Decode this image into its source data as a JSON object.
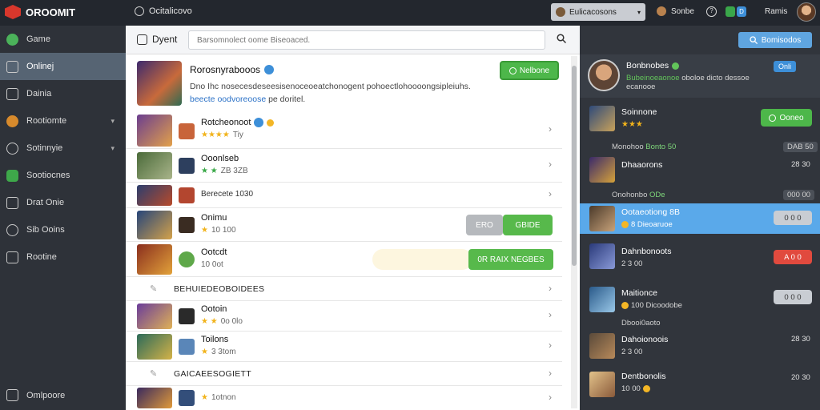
{
  "topbar": {
    "app_name": "OROOMIT",
    "page_title": "Ocitalicovo",
    "dropdown_label": "Eulicacosons",
    "user_label": "Sonbe",
    "help_glyph": "?",
    "badge_1": "",
    "badge_2": "D",
    "account_name": "Ramis"
  },
  "sidebar": {
    "items": [
      {
        "label": "Game",
        "icon": "game-icon"
      },
      {
        "label": "Onlinej",
        "icon": "monitor-icon"
      },
      {
        "label": "Dainia",
        "icon": "document-icon"
      },
      {
        "label": "Rootiomte",
        "icon": "orange-globe-icon"
      },
      {
        "label": "Sotinnyie",
        "icon": "cloud-icon"
      },
      {
        "label": "Sootiocnes",
        "icon": "green-badge-icon"
      },
      {
        "label": "Drat Onie",
        "icon": "grid-icon"
      },
      {
        "label": "Sib Ooins",
        "icon": "circle-arrow-icon"
      },
      {
        "label": "Rootine",
        "icon": "table-icon"
      }
    ],
    "footer_label": "Omlpoore"
  },
  "main": {
    "header_label": "Dyent",
    "search_placeholder": "Barsomnolect oome Biseoaced.",
    "featured": {
      "title": "Rorosnyrabooos",
      "desc_line1": "Dno Ihc nosecesdeseesisenoceoeatchonogent pohoectlohoooongsipleiuhs.",
      "desc_link": "beecte oodvoreoose",
      "desc_line2_rest": "pe doritel.",
      "action_label": "Nelbone"
    },
    "rows": [
      {
        "title": "Rotcheonoot",
        "sub": "Tiy",
        "stars": "★★★★"
      },
      {
        "title": "Ooonlseb",
        "sub": "ZB 3ZB",
        "stars": "★ ★"
      },
      {
        "title": "",
        "sub": "Berecete 1030",
        "stars": ""
      },
      {
        "title": "Onimu",
        "sub": "10 100",
        "stars": "★",
        "btn_gray": "ERO",
        "btn_green": "GBIDE"
      },
      {
        "title": "Ootcdt",
        "sub": "10 0ot",
        "stars": "",
        "btn_green": "0R RAIX NEGBES"
      },
      {
        "title": "Ootoin",
        "sub": "0o 0lo",
        "stars": "★ ★"
      },
      {
        "title": "Toilons",
        "sub": "3 3tom",
        "stars": "★"
      },
      {
        "title": "",
        "sub": "1otnon",
        "stars": "★"
      }
    ],
    "sections": [
      "BEHUIEDEOBOIDEES",
      "GAICAEESOGIETT"
    ],
    "chevron": "›"
  },
  "right": {
    "search_label": "Bomisodos",
    "profile": {
      "name": "Bonbnobes",
      "status_prefix": "Bubeinoeaonoe",
      "status_rest": "oboloe dicto dessoe",
      "status_line2": "ecanooe",
      "tag": "Onli"
    },
    "items": [
      {
        "title": "Soinnone",
        "meta": "★★★",
        "action": "Ooneo"
      },
      {
        "title": "Dhaaorons",
        "meta": "",
        "count": "28 30"
      },
      {
        "title": "Ootaeotiong 8B",
        "meta": "8 Dieoaruoe",
        "action": "0 0 0"
      },
      {
        "title": "Dahnbonoots",
        "meta": "2 3 00",
        "action": "A 0 0"
      },
      {
        "title": "Maitionce",
        "meta": "100 Dicoodobe",
        "action": "0 0 0"
      },
      {
        "title": "Dahoionoois",
        "meta": "2 3 00",
        "count": "28 30"
      },
      {
        "title": "Dentbonolis",
        "meta": "10 00",
        "count": "20 30"
      }
    ],
    "dividers": [
      {
        "prefix": "Monohoo",
        "hl": "Bonto 50",
        "tail": "DAB 50"
      },
      {
        "prefix": "Onohonbo",
        "hl": "ODe",
        "tail": "000 00"
      }
    ],
    "footer_label": "Dbooi0aoto"
  }
}
